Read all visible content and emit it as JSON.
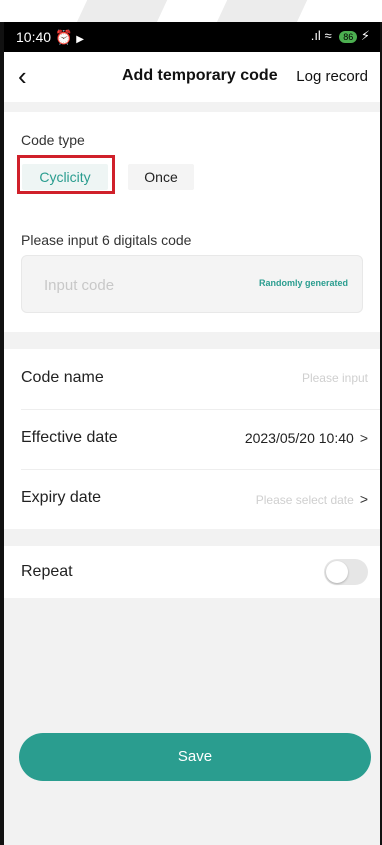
{
  "status": {
    "time": "10:40",
    "signal_icons": ".ıl",
    "battery": "86"
  },
  "header": {
    "back_symbol": "‹",
    "title": "Add temporary code",
    "log_record": "Log record"
  },
  "code_type": {
    "label": "Code type",
    "options": [
      "Cyclicity",
      "Once"
    ],
    "selected": "Cyclicity"
  },
  "code_input": {
    "label": "Please input 6 digitals code",
    "placeholder": "Input code",
    "value": "",
    "random_link": "Randomly generated"
  },
  "fields": {
    "code_name": {
      "label": "Code name",
      "placeholder": "Please input"
    },
    "effective_date": {
      "label": "Effective date",
      "value": "2023/05/20 10:40"
    },
    "expiry_date": {
      "label": "Expiry date",
      "placeholder": "Please select date"
    }
  },
  "repeat": {
    "label": "Repeat",
    "enabled": false
  },
  "save_label": "Save",
  "colors": {
    "accent": "#2a9d8f",
    "highlight": "#d0202a"
  }
}
